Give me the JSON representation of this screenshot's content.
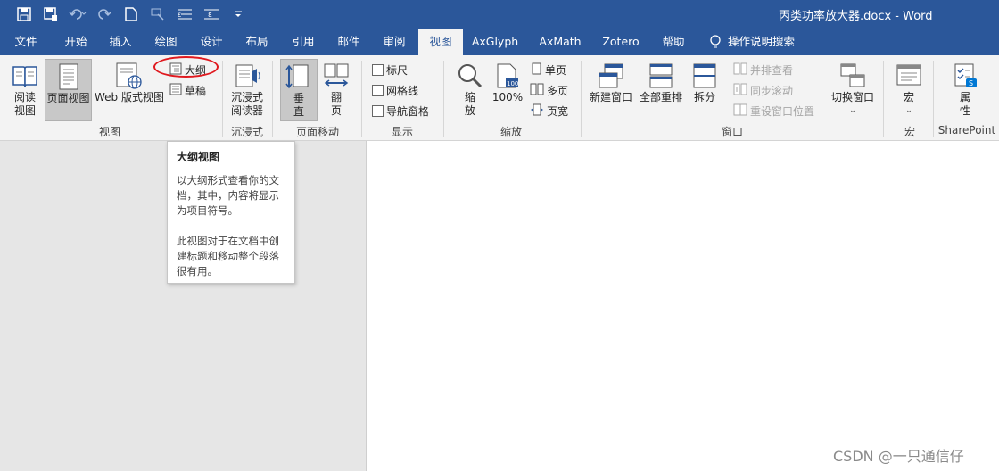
{
  "title_bar": {
    "doc_title": "丙类功率放大器.docx  -  Word",
    "qat_icons": [
      "save-icon",
      "save-as-icon",
      "undo-icon",
      "redo-icon",
      "new-doc-icon",
      "touch-mode-icon",
      "format-icon",
      "format2-icon",
      "customize-icon"
    ]
  },
  "tabs": [
    {
      "label": "文件"
    },
    {
      "label": "开始"
    },
    {
      "label": "插入"
    },
    {
      "label": "绘图"
    },
    {
      "label": "设计"
    },
    {
      "label": "布局"
    },
    {
      "label": "引用"
    },
    {
      "label": "邮件"
    },
    {
      "label": "审阅"
    },
    {
      "label": "视图",
      "active": true
    },
    {
      "label": "AxGlyph"
    },
    {
      "label": "AxMath"
    },
    {
      "label": "Zotero"
    },
    {
      "label": "帮助"
    }
  ],
  "tell_me": "操作说明搜索",
  "ribbon": {
    "views": {
      "read_mode_l1": "阅读",
      "read_mode_l2": "视图",
      "print_layout": "页面视图",
      "web_layout": "Web 版式视图",
      "outline": "大纲",
      "draft": "草稿",
      "group": "视图"
    },
    "immersive": {
      "reader_l1": "沉浸式",
      "reader_l2": "阅读器",
      "group": "沉浸式"
    },
    "page_movement": {
      "vertical_l1": "垂",
      "vertical_l2": "直",
      "side_l1": "翻",
      "side_l2": "页",
      "group": "页面移动"
    },
    "show": {
      "ruler": "标尺",
      "gridlines": "网格线",
      "nav_pane": "导航窗格",
      "group": "显示"
    },
    "zoom": {
      "zoom_l1": "缩",
      "zoom_l2": "放",
      "hundred": "100%",
      "one_page": "单页",
      "multi_page": "多页",
      "page_width": "页宽",
      "group": "缩放"
    },
    "window": {
      "new_window": "新建窗口",
      "arrange_all": "全部重排",
      "split": "拆分",
      "side_by_side": "并排查看",
      "sync_scroll": "同步滚动",
      "reset_pos": "重设窗口位置",
      "switch": "切换窗口",
      "group": "窗口"
    },
    "macros": {
      "label": "宏",
      "group": "宏"
    },
    "sharepoint": {
      "prop_l1": "属",
      "prop_l2": "性",
      "group": "SharePoint"
    }
  },
  "tooltip": {
    "title": "大纲视图",
    "body1": "以大纲形式查看你的文档，其中，内容将显示为项目符号。",
    "body2": "此视图对于在文档中创建标题和移动整个段落很有用。"
  },
  "watermark": "CSDN @一只通信仔",
  "colors": {
    "brand": "#2b579a",
    "annotation": "#e0191f"
  }
}
